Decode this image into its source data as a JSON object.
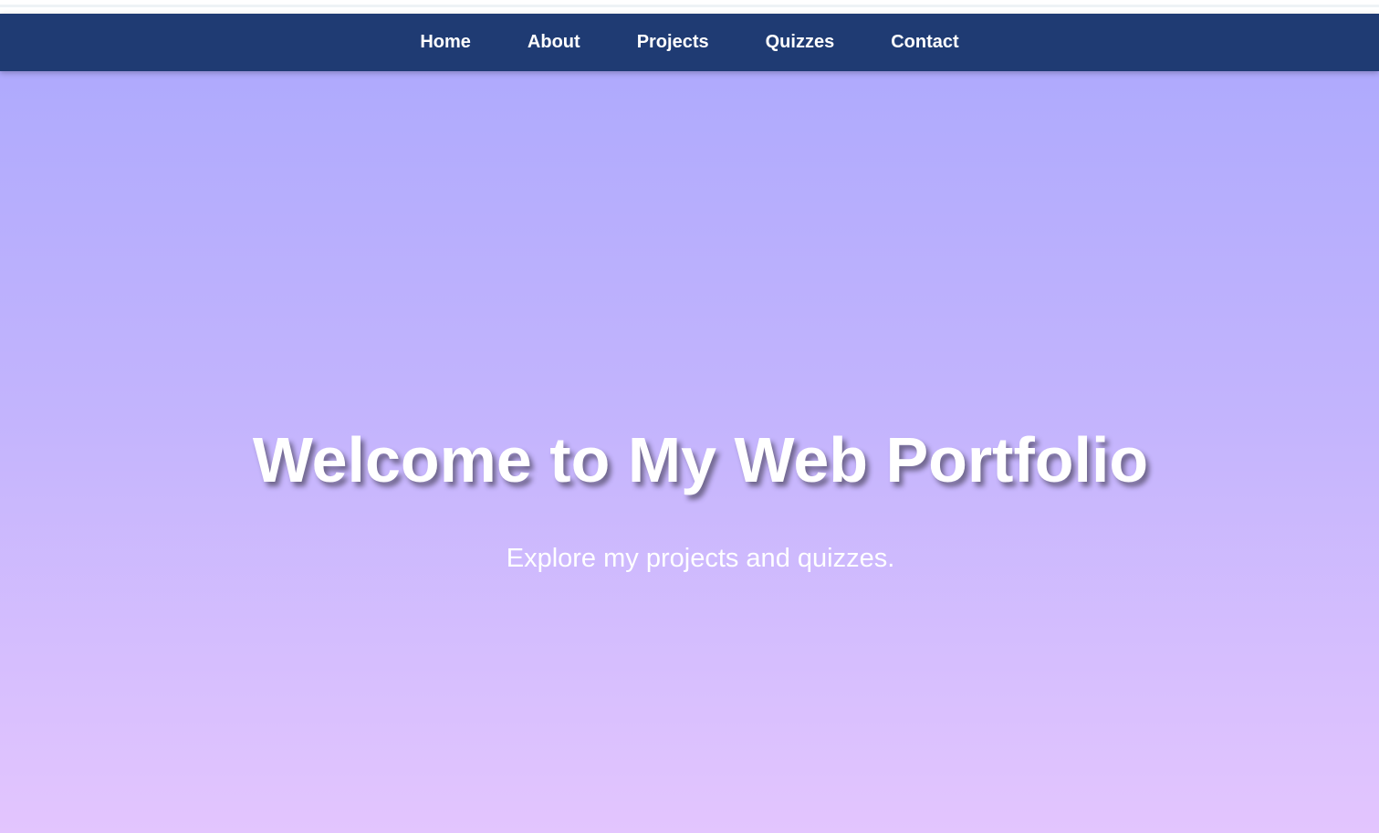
{
  "nav": {
    "items": [
      {
        "label": "Home"
      },
      {
        "label": "About"
      },
      {
        "label": "Projects"
      },
      {
        "label": "Quizzes"
      },
      {
        "label": "Contact"
      }
    ]
  },
  "hero": {
    "title": "Welcome to My Web Portfolio",
    "subtitle": "Explore my projects and quizzes."
  },
  "colors": {
    "nav_background": "#1f3b73",
    "hero_gradient_top": "#afaafd",
    "hero_gradient_bottom": "#e3c5fe",
    "text": "#ffffff"
  }
}
